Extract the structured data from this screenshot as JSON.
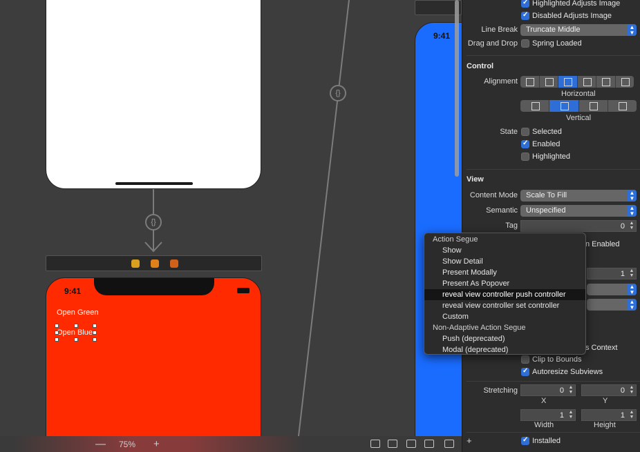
{
  "canvas": {
    "red_scene": {
      "time": "9:41",
      "btn_green": "Open Green",
      "btn_blue": "Open Blue"
    },
    "blue_scene": {
      "time": "9:41"
    },
    "segue_glyph": "{}",
    "zoom": {
      "minus": "—",
      "value": "75%",
      "plus": "+"
    }
  },
  "inspector": {
    "button": {
      "highlighted_adjusts": "Highlighted Adjusts Image",
      "disabled_adjusts": "Disabled Adjusts Image",
      "line_break_label": "Line Break",
      "line_break_value": "Truncate Middle",
      "drag_drop_label": "Drag and Drop",
      "spring_loaded": "Spring Loaded"
    },
    "control": {
      "title": "Control",
      "alignment_label": "Alignment",
      "horizontal_label": "Horizontal",
      "vertical_label": "Vertical",
      "horizontal_selected_index": 2,
      "vertical_selected_index": 1,
      "state_label": "State",
      "selected": "Selected",
      "enabled": "Enabled",
      "highlighted": "Highlighted"
    },
    "view": {
      "title": "View",
      "content_mode_label": "Content Mode",
      "content_mode_value": "Scale To Fill",
      "semantic_label": "Semantic",
      "semantic_value": "Unspecified",
      "tag_label": "Tag",
      "tag_value": "0",
      "interaction_partial": "n Enabled",
      "alpha_value": "1",
      "context_partial": "s Context",
      "clip_bounds": "Clip to Bounds",
      "autoresize": "Autoresize Subviews",
      "stretching_label": "Stretching",
      "stretch_x": "0",
      "stretch_y": "0",
      "x_label": "X",
      "y_label": "Y",
      "stretch_w": "1",
      "stretch_h": "1",
      "width_label": "Width",
      "height_label": "Height",
      "add_label": "+",
      "installed": "Installed"
    }
  },
  "segue_menu": {
    "action_header": "Action Segue",
    "show": "Show",
    "show_detail": "Show Detail",
    "present_modally": "Present Modally",
    "present_popover": "Present As Popover",
    "reveal_push": "reveal view controller push controller",
    "reveal_set": "reveal view controller set controller",
    "custom": "Custom",
    "non_adaptive_header": "Non-Adaptive Action Segue",
    "push_deprecated": "Push (deprecated)",
    "modal_deprecated": "Modal (deprecated)"
  },
  "colors": {
    "accent": "#2f6ed6",
    "red_scene": "#ff2a00",
    "blue_scene": "#1a6cff"
  }
}
